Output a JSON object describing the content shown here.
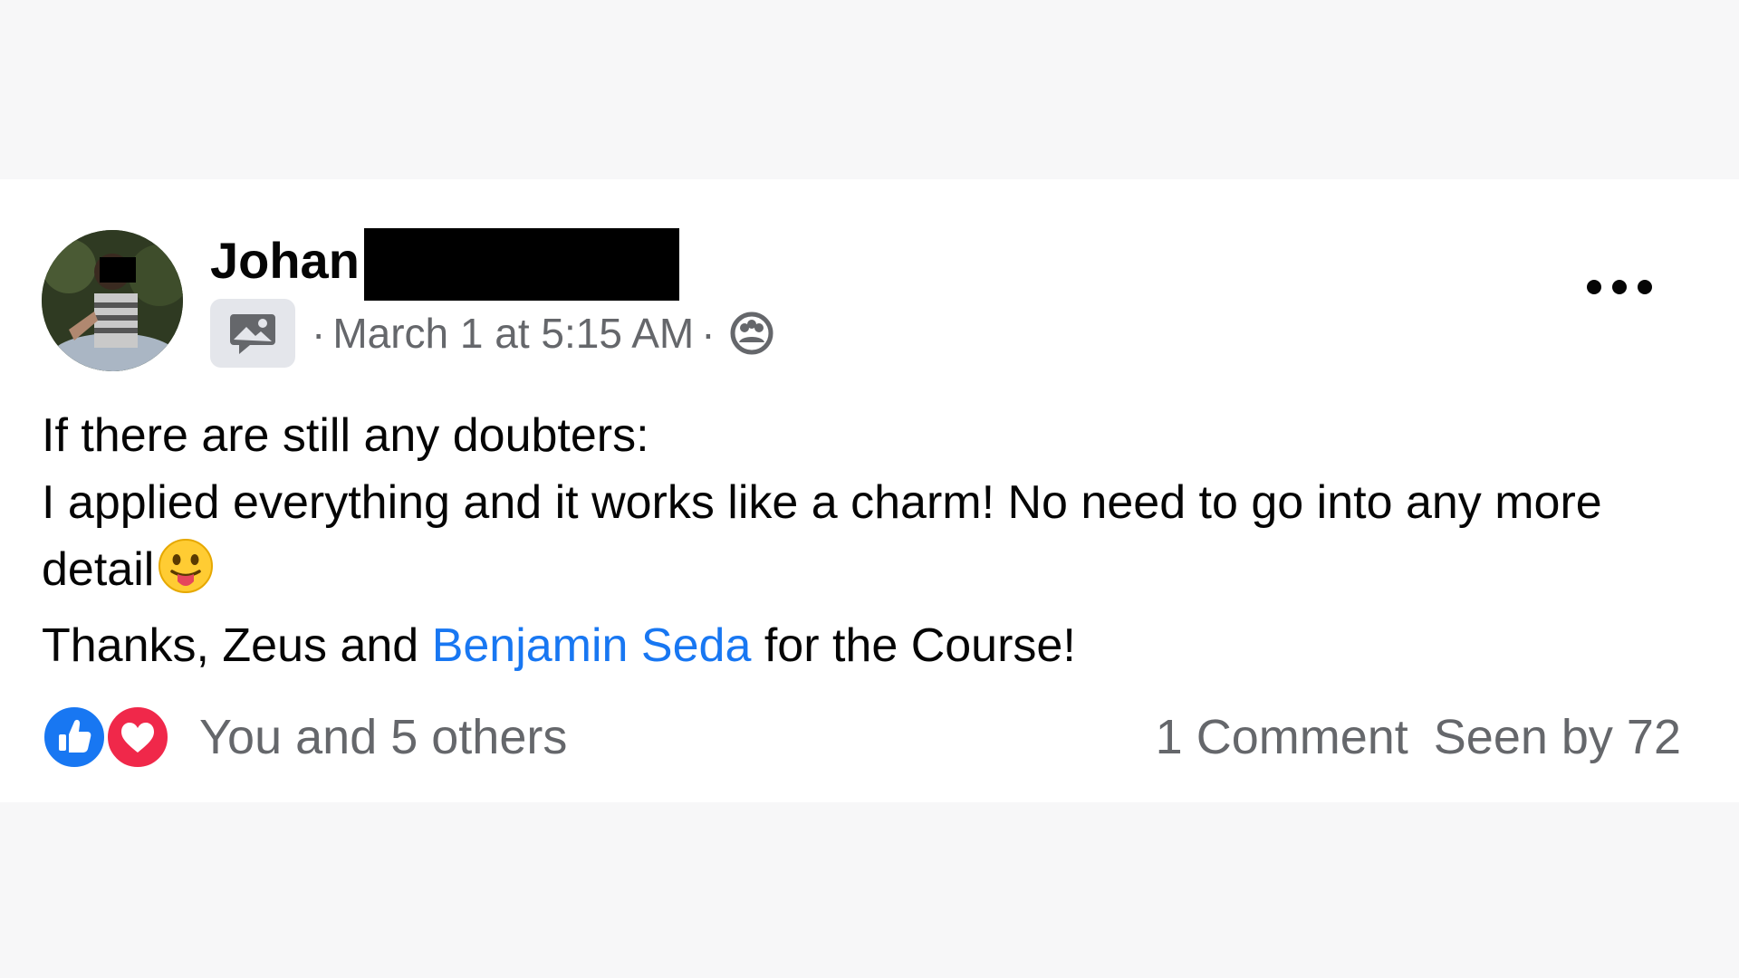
{
  "post": {
    "author_name": "Johan",
    "timestamp": "March 1 at 5:15 AM",
    "separator": "·",
    "body": {
      "line1": "If there are still any doubters:",
      "line2": "I applied everything and it works like a charm! No need to go into any more detail",
      "line3_before": "Thanks, Zeus and ",
      "line3_mention": "Benjamin Seda",
      "line3_after": " for the Course!"
    },
    "reactions": {
      "summary": "You and 5 others",
      "types": [
        "like",
        "love"
      ]
    },
    "comments_label": "1 Comment",
    "seen_label": "Seen by 72"
  },
  "icons": {
    "group_badge": "group-photo-icon",
    "audience": "group-audience-icon",
    "more": "more-options-icon",
    "emoji": "tongue-out-emoji"
  },
  "colors": {
    "mention": "#1877f2",
    "like": "#1877f2",
    "love": "#f0284a",
    "meta_text": "#65676b"
  }
}
